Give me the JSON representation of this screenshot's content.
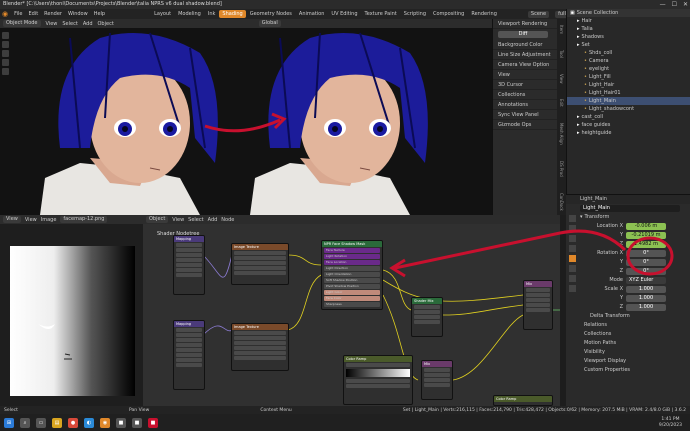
{
  "title_bar": {
    "title": "Blender* [C:\\Users\\thoni\\Documents\\Projects\\Blender\\talia NPRS v6 dual shadow.blend]",
    "minimize": "—",
    "maximize": "☐",
    "close": "✕"
  },
  "menu": {
    "items": [
      "File",
      "Edit",
      "Render",
      "Window",
      "Help"
    ],
    "workspaces": [
      "Layout",
      "Modeling",
      "Ink",
      "Shading",
      "Geometry Nodes",
      "Animation",
      "UV Editing",
      "Texture Paint",
      "Scripting",
      "Compositing",
      "Rendering"
    ],
    "active_workspace": "Shading",
    "scene_label": "Scene",
    "view_layer_label": "full"
  },
  "viewport": {
    "mode": "Object Mode",
    "menus": [
      "View",
      "Select",
      "Add",
      "Object"
    ],
    "transform": "Global"
  },
  "viewport_panel": {
    "title": "Viewport Rendering",
    "button": "Diff",
    "bg_color": "Background Color",
    "line_size": "Line Size Adjustment",
    "camera_view": "Camera View Option",
    "sections": [
      "View",
      "3D Cursor",
      "Collections",
      "Annotations",
      "Sync View Panel",
      "Gizmode Ops"
    ]
  },
  "side_tabs": [
    "Item",
    "Tool",
    "View",
    "Edit",
    "Mesh Align",
    "DS Prod",
    "ConDock"
  ],
  "outliner": {
    "title": "Scene Collection",
    "items": [
      {
        "label": "Hair",
        "indent": 1
      },
      {
        "label": "Talia",
        "indent": 1
      },
      {
        "label": "Shadows",
        "indent": 1
      },
      {
        "label": "Set",
        "indent": 1
      },
      {
        "label": "Shds_coll",
        "indent": 2
      },
      {
        "label": "Camera",
        "indent": 2
      },
      {
        "label": "eyelight",
        "indent": 2
      },
      {
        "label": "Light_Fill",
        "indent": 2
      },
      {
        "label": "Light_Hair",
        "indent": 2
      },
      {
        "label": "Light_Hair01",
        "indent": 2
      },
      {
        "label": "Light_Main",
        "indent": 2
      },
      {
        "label": "Light_shadowcont",
        "indent": 2
      },
      {
        "label": "cast_coll",
        "indent": 1
      },
      {
        "label": "face guides",
        "indent": 1
      },
      {
        "label": "heightguide",
        "indent": 1
      }
    ]
  },
  "properties": {
    "object_name": "Light_Main",
    "name_field": "Light_Main",
    "transform": "Transform",
    "location_label": "Location X",
    "y_label": "Y",
    "z_label": "Z",
    "location": [
      "-0.006 m",
      "-0.21019 m",
      "1.4982 m"
    ],
    "rotation_label": "Rotation X",
    "rotation": [
      "0°",
      "0°",
      "0°"
    ],
    "mode_label": "Mode",
    "rotation_mode": "XYZ Euler",
    "scale_label": "Scale X",
    "scale": [
      "1.000",
      "1.000",
      "1.000"
    ],
    "sections": [
      "Delta Transform",
      "Relations",
      "Collections",
      "Motion Paths",
      "Visibility",
      "Viewport Display",
      "Custom Properties"
    ]
  },
  "image_editor": {
    "menus": [
      "View",
      "View",
      "Image"
    ],
    "image": "facemap-12.png"
  },
  "node_editor": {
    "menus": [
      "Object",
      "View",
      "Select",
      "Add",
      "Node"
    ],
    "mode": "Object",
    "breadcrumb": "Shader Nodetree",
    "nodes": [
      {
        "title": "Mapping"
      },
      {
        "title": "Image Texture"
      },
      {
        "title": "NPR Face Shadow Mask",
        "rows": [
          "Face Texture",
          "Light Rotation",
          "Face Location",
          "Light Direction",
          "Light Orientation",
          "Soft Shadow Position",
          "Pivot Shadow Position",
          "Light Color",
          "Face Color",
          "Sharpness"
        ]
      },
      {
        "title": "Mapping"
      },
      {
        "title": "Image Texture"
      },
      {
        "title": "Shader Mix"
      },
      {
        "title": "Mix"
      },
      {
        "title": "Color Ramp"
      },
      {
        "title": "Mix"
      },
      {
        "title": "Color Ramp"
      }
    ]
  },
  "status_bar": {
    "left": "Select",
    "middle": "Pan View",
    "right_context": "Context Menu",
    "info": "Set | Light_Main | Verts:216,115 | Faces:214,790 | Tris:428,472 | Objects:0/62 | Memory: 207.5 MiB | VRAM: 2.4/8.0 GiB | 3.6.2"
  },
  "taskbar": {
    "time": "1:41 PM",
    "date": "9/20/2023"
  },
  "accent_colors": {
    "active_tab": "#e0882a",
    "annotation_red": "#c8102e",
    "selected_field": "#8cc152",
    "purple_node": "#6a2a8a",
    "yellow_wire": "#e0d020"
  }
}
